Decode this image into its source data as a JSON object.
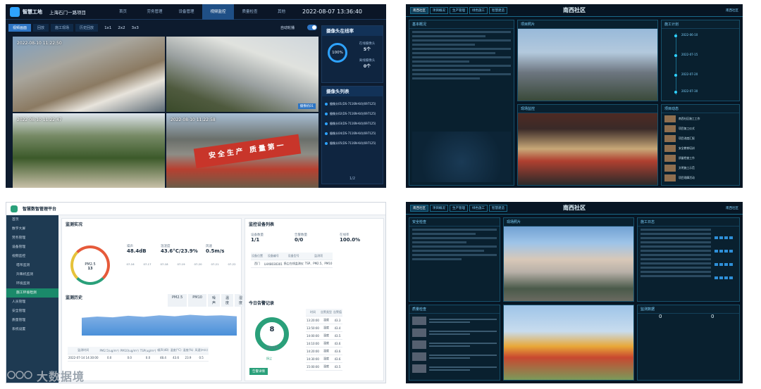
{
  "q1": {
    "brand": "智慧工地",
    "project": "上海石门一路项目",
    "nav": [
      "首页",
      "劳务管理",
      "设备管理",
      "视频监控",
      "质量检查",
      "其他"
    ],
    "nav_active_index": 3,
    "time": "2022-08-07  13:36:40",
    "sub_tabs": [
      "视频画面",
      "回放",
      "施工现场",
      "历史回放"
    ],
    "grid_options": [
      "1x1",
      "2x2",
      "3x3"
    ],
    "auto_rotate": "自动轮播",
    "camera_timestamps": [
      "2022-08-10  11:22:50",
      "",
      "2022-08-10  11:22:47",
      "2022-08-10  11:22:58"
    ],
    "camera_label": "摄像机01",
    "banner": "安全生产 质量第一",
    "online_panel": {
      "title": "摄像头在线率",
      "rate": "100%",
      "online_label": "在线摄像头",
      "online_value": "5个",
      "offline_label": "离线摄像头",
      "offline_value": "0个"
    },
    "list_panel": {
      "title": "摄像头列表",
      "items": [
        "摄像头01(DS-7116N-K4)(697125)",
        "摄像头02(DS-7116N-K4)(697125)",
        "摄像头03(DS-7116N-K4)(697125)",
        "摄像头04(DS-7116N-K4)(697125)",
        "摄像头05(DS-7116N-K4)(697125)"
      ],
      "pager": "1/2"
    }
  },
  "q2": {
    "title": "南西社区",
    "tabs": [
      "南西社区",
      "项目概况",
      "生产管理",
      "绿色施工",
      "智慧建造"
    ],
    "right_tag": "南西社区",
    "panels": [
      "基本概况",
      "项目照片",
      "施工计划",
      "现场监控",
      "项目动态"
    ],
    "timeline": [
      "2022-06-10",
      "2022-07-15",
      "2022-07-20",
      "2022-07-30"
    ],
    "news": [
      "南西社区施工工作",
      "项目复工仪式",
      "项目进度汇报",
      "安全教育培训",
      "质量检查工作",
      "文明施工示范",
      "项目观摩活动"
    ]
  },
  "q3": {
    "brand": "智慧数智管理平台",
    "sidebar": [
      "首页",
      "数字大屏",
      "劳务管理",
      "设备管理",
      "视频监控",
      "塔吊监测",
      "升降机监测",
      "环境监测",
      "施工环境检测",
      "人员管理",
      "安全管理",
      "质量管理",
      "系统设置"
    ],
    "sidebar_active_index": 8,
    "main_title": "监测实况",
    "gauge_label": "PM2.5",
    "gauge_value": "13",
    "metrics": [
      {
        "label": "噪声",
        "value": "48.4dB"
      },
      {
        "label": "温湿度",
        "value": "43.6°C/23.9%"
      },
      {
        "label": "风速",
        "value": "0.5m/s"
      }
    ],
    "forecast": [
      "07-16",
      "07-17",
      "07-18",
      "07-19",
      "07-20",
      "07-21",
      "07-22"
    ],
    "history_title": "监测历史",
    "history_filters": [
      "PM2.5",
      "PM10",
      "噪声",
      "温度",
      "湿度"
    ],
    "table_headers": [
      "监测时间",
      "PM2.5(ug/m³)",
      "PM10(ug/m³)",
      "TSP(ug/m³)",
      "噪声(dB)",
      "温度(°C)",
      "湿度(%)",
      "风速(m/s)"
    ],
    "table_row": [
      "2022-07-14 14:30:00",
      "0.0",
      "0.0",
      "0.0",
      "48.4",
      "43.6",
      "23.9",
      "0.5"
    ],
    "right_title": "监控设备列表",
    "right_stats": [
      {
        "label": "设备数量",
        "value": "1/1"
      },
      {
        "label": "告警数量",
        "value": "0/0"
      },
      {
        "label": "在线率",
        "value": "100.0%"
      }
    ],
    "device_headers": [
      "设备位置",
      "设备编号",
      "设备型号",
      "监测项"
    ],
    "device_row": [
      "西门",
      "LHX8030301",
      "扬尘在线监测仪",
      "TSP、PM2.5、PM10"
    ],
    "alarm_title": "今日告警记录",
    "alarm_count": "8",
    "alarm_count_label": "告警总次数",
    "alarm_legend": "扬尘",
    "alarm_headers": [
      "时间",
      "告警类型",
      "告警值"
    ],
    "alarm_rows": [
      [
        "13:20:00",
        "温度",
        "43.3"
      ],
      [
        "13:50:00",
        "温度",
        "43.4"
      ],
      [
        "14:00:00",
        "温度",
        "43.5"
      ],
      [
        "14:10:00",
        "温度",
        "43.6"
      ],
      [
        "14:20:00",
        "温度",
        "43.6"
      ],
      [
        "14:30:00",
        "温度",
        "43.6"
      ],
      [
        "15:00:00",
        "温度",
        "43.5"
      ]
    ],
    "alarm_button": "告警详情"
  },
  "q4": {
    "title": "南西社区",
    "tabs": [
      "南西社区",
      "项目概况",
      "生产管理",
      "绿色施工",
      "智慧建造"
    ],
    "right_tag": "南西社区",
    "panels": [
      "安全检查",
      "现场照片",
      "质量检查",
      "施工日志",
      "监测数据"
    ],
    "kpi_left": "0",
    "kpi_right": "0"
  },
  "watermark": "大数据境"
}
